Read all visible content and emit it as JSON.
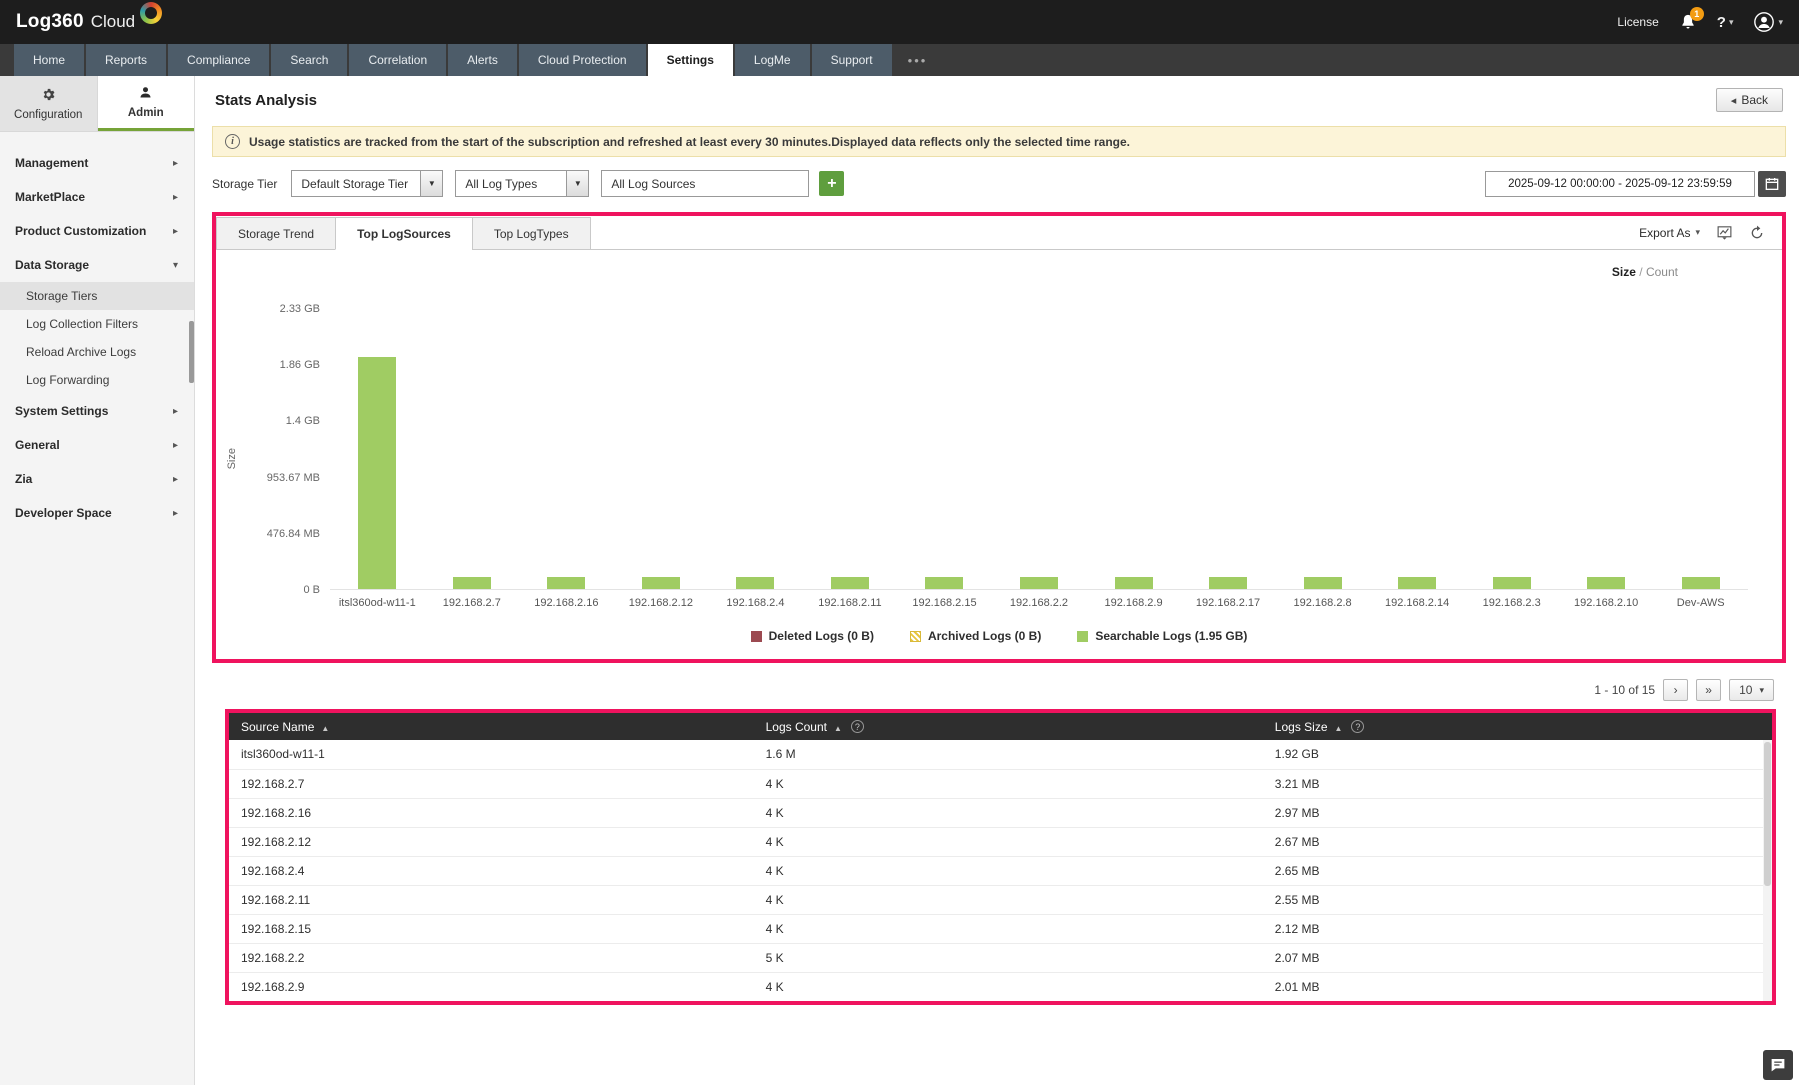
{
  "colors": {
    "highlight": "#ef135e",
    "bar-green": "#a0cc63",
    "accent-green": "#76a338",
    "plus-green": "#5f9e3e",
    "banner-bg": "#fcf4d8",
    "table-header-bg": "#2e2e2e",
    "nav-tab-bg": "#4d5c69",
    "topbar-bg": "#1d1d1d"
  },
  "header": {
    "logo_primary": "Log360",
    "logo_secondary": "Cloud",
    "license_label": "License",
    "notification_badge": "1",
    "help_label": "?"
  },
  "nav": {
    "tabs": [
      "Home",
      "Reports",
      "Compliance",
      "Search",
      "Correlation",
      "Alerts",
      "Cloud Protection",
      "Settings",
      "LogMe",
      "Support"
    ],
    "active_tab": "Settings",
    "more_label": "•••"
  },
  "sidebar": {
    "tabs": [
      {
        "label": "Configuration",
        "active": false,
        "icon": "gear"
      },
      {
        "label": "Admin",
        "active": true,
        "icon": "person"
      }
    ],
    "items": [
      {
        "label": "Management",
        "kind": "group"
      },
      {
        "label": "MarketPlace",
        "kind": "group"
      },
      {
        "label": "Product Customization",
        "kind": "group"
      },
      {
        "label": "Data Storage",
        "kind": "group",
        "expanded": true
      },
      {
        "label": "Storage Tiers",
        "kind": "child",
        "selected": true
      },
      {
        "label": "Log Collection Filters",
        "kind": "child"
      },
      {
        "label": "Reload Archive Logs",
        "kind": "child"
      },
      {
        "label": "Log Forwarding",
        "kind": "child"
      },
      {
        "label": "System Settings",
        "kind": "group"
      },
      {
        "label": "General",
        "kind": "group"
      },
      {
        "label": "Zia",
        "kind": "group"
      },
      {
        "label": "Developer Space",
        "kind": "group"
      }
    ]
  },
  "page": {
    "title": "Stats Analysis",
    "back_label": "Back",
    "info_banner": "Usage statistics are tracked from the start of the subscription and refreshed at least every 30 minutes.Displayed data reflects only the selected time range."
  },
  "filters": {
    "storage_tier_label": "Storage Tier",
    "storage_tier_value": "Default Storage Tier",
    "log_types_value": "All Log Types",
    "log_sources_value": "All Log Sources",
    "add_label": "+",
    "date_range": "2025-09-12 00:00:00 - 2025-09-12 23:59:59"
  },
  "chart_panel": {
    "tabs": [
      "Storage Trend",
      "Top LogSources",
      "Top LogTypes"
    ],
    "active_tab": "Top LogSources",
    "export_label": "Export As",
    "size_label": "Size",
    "separator": "/",
    "count_label": "Count"
  },
  "chart_data": {
    "type": "bar",
    "title": "Top LogSources",
    "xlabel": "",
    "ylabel": "Size",
    "y_ticks": [
      "2.33 GB",
      "1.86 GB",
      "1.4 GB",
      "953.67 MB",
      "476.84 MB",
      "0 B"
    ],
    "ylim_mb": [
      0,
      2384.2
    ],
    "grid": false,
    "legend_position": "bottom",
    "categories": [
      "itsl360od-w11-1",
      "192.168.2.7",
      "192.168.2.16",
      "192.168.2.12",
      "192.168.2.4",
      "192.168.2.11",
      "192.168.2.15",
      "192.168.2.2",
      "192.168.2.9",
      "192.168.2.17",
      "192.168.2.8",
      "192.168.2.14",
      "192.168.2.3",
      "192.168.2.10",
      "Dev-AWS"
    ],
    "series": [
      {
        "name": "Deleted Logs",
        "total": "0 B",
        "color": "#9c4a51",
        "pattern": "solid"
      },
      {
        "name": "Archived Logs",
        "total": "0 B",
        "color": "#e8c53d",
        "pattern": "striped"
      },
      {
        "name": "Searchable Logs",
        "total": "1.95 GB",
        "color": "#a0cc63",
        "pattern": "solid",
        "values_mb": [
          1966.08,
          3.21,
          2.97,
          2.67,
          2.65,
          2.55,
          2.12,
          2.07,
          2.01,
          2,
          2,
          2,
          2,
          2,
          2
        ]
      }
    ]
  },
  "pagination": {
    "range_label": "1 - 10 of 15",
    "page_size": "10"
  },
  "table": {
    "columns": [
      {
        "label": "Source Name",
        "sort": "asc",
        "help": false
      },
      {
        "label": "Logs Count",
        "sort": "asc",
        "help": true
      },
      {
        "label": "Logs Size",
        "sort": "asc",
        "help": true
      }
    ],
    "rows": [
      [
        "itsl360od-w11-1",
        "1.6 M",
        "1.92 GB"
      ],
      [
        "192.168.2.7",
        "4 K",
        "3.21 MB"
      ],
      [
        "192.168.2.16",
        "4 K",
        "2.97 MB"
      ],
      [
        "192.168.2.12",
        "4 K",
        "2.67 MB"
      ],
      [
        "192.168.2.4",
        "4 K",
        "2.65 MB"
      ],
      [
        "192.168.2.11",
        "4 K",
        "2.55 MB"
      ],
      [
        "192.168.2.15",
        "4 K",
        "2.12 MB"
      ],
      [
        "192.168.2.2",
        "5 K",
        "2.07 MB"
      ],
      [
        "192.168.2.9",
        "4 K",
        "2.01 MB"
      ]
    ]
  }
}
